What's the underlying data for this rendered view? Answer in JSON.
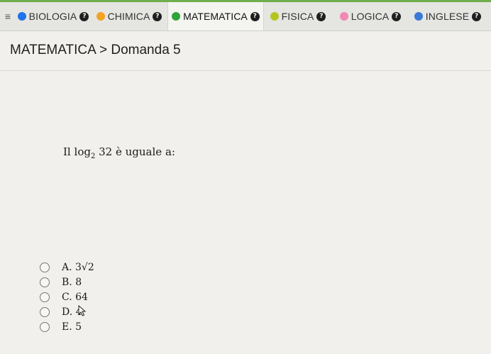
{
  "tabs": [
    {
      "label": "BIOLOGIA",
      "color": "#1e74e8",
      "help": "?"
    },
    {
      "label": "CHIMICA",
      "color": "#f3a224",
      "help": "?"
    },
    {
      "label": "MATEMATICA",
      "color": "#2fa43a",
      "help": "?",
      "active": true
    },
    {
      "label": "FISICA",
      "color": "#b5c51f",
      "help": "?"
    },
    {
      "label": "LOGICA",
      "color": "#f08ab0",
      "help": "?"
    },
    {
      "label": "INGLESE",
      "color": "#3b79d8",
      "help": "?"
    }
  ],
  "breadcrumb": {
    "subject": "MATEMATICA",
    "separator": ">",
    "item": "Domanda 5"
  },
  "question": {
    "prefix": "Il",
    "func": "log",
    "base": "2",
    "arg": "32",
    "suffix": "è uguale a:"
  },
  "answers": [
    {
      "letter": "A.",
      "text": "3√2"
    },
    {
      "letter": "B.",
      "text": "8"
    },
    {
      "letter": "C.",
      "text": "64"
    },
    {
      "letter": "D.",
      "text": "4"
    },
    {
      "letter": "E.",
      "text": "5"
    }
  ]
}
